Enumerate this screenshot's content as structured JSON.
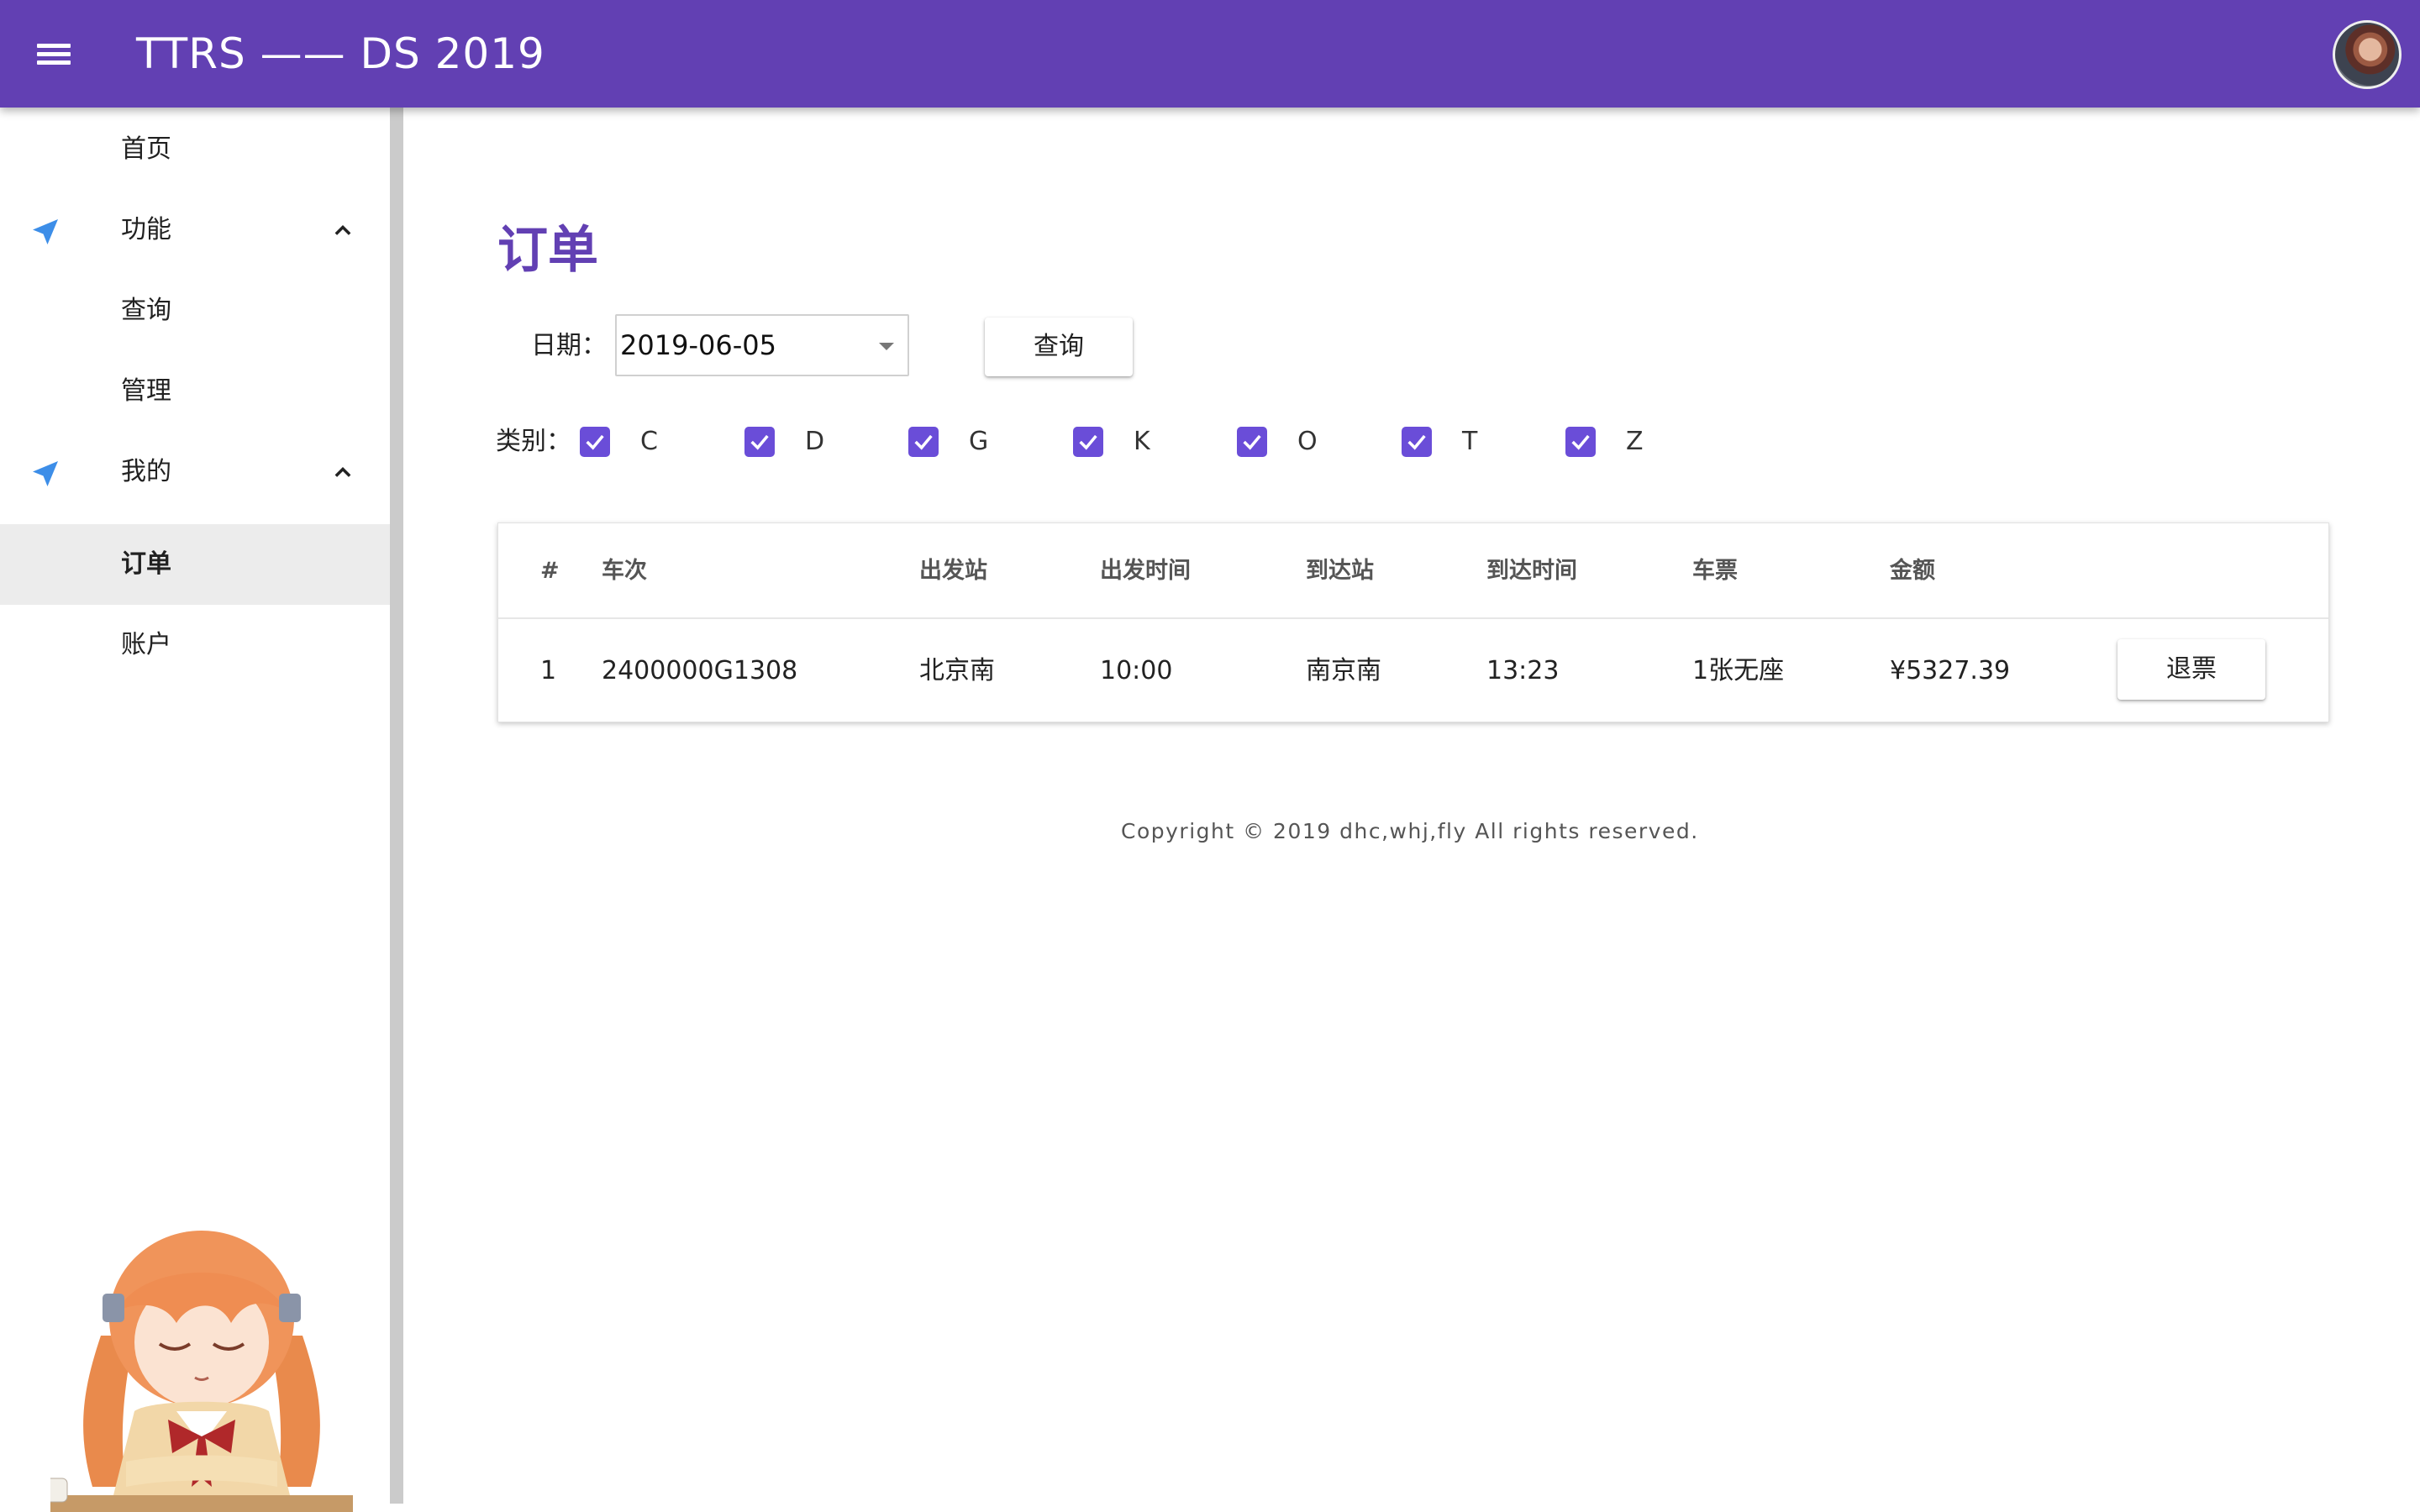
{
  "app": {
    "title": "TTRS —— DS 2019"
  },
  "sidebar": {
    "items": [
      {
        "label": "首页"
      },
      {
        "label": "功能"
      },
      {
        "label": "查询"
      },
      {
        "label": "管理"
      },
      {
        "label": "我的"
      },
      {
        "label": "订单"
      },
      {
        "label": "账户"
      }
    ]
  },
  "main": {
    "title": "订单",
    "date_label": "日期：",
    "date_value": "2019-06-05",
    "query_label": "查询",
    "type_label": "类别：",
    "types": [
      {
        "label": "C",
        "checked": true
      },
      {
        "label": "D",
        "checked": true
      },
      {
        "label": "G",
        "checked": true
      },
      {
        "label": "K",
        "checked": true
      },
      {
        "label": "O",
        "checked": true
      },
      {
        "label": "T",
        "checked": true
      },
      {
        "label": "Z",
        "checked": true
      }
    ],
    "table": {
      "headers": [
        "#",
        "车次",
        "出发站",
        "出发时间",
        "到达站",
        "到达时间",
        "车票",
        "金额"
      ],
      "rows": [
        {
          "index": "1",
          "train": "2400000G1308",
          "from": "北京南",
          "depart": "10:00",
          "to": "南京南",
          "arrive": "13:23",
          "ticket": "1张无座",
          "price": "¥5327.39",
          "action": "退票"
        }
      ]
    }
  },
  "footer": {
    "text": "Copyright © 2019 dhc,whj,fly All rights reserved."
  },
  "colors": {
    "primary": "#6240b3",
    "checkbox": "#6a4dd8",
    "nav_icon": "#3d8ee8",
    "active_bg": "#ececec"
  },
  "icons": {
    "menu": "hamburger-icon",
    "section": "navigation-arrow-icon",
    "expand": "chevron-up-icon",
    "check": "checkmark-icon"
  }
}
